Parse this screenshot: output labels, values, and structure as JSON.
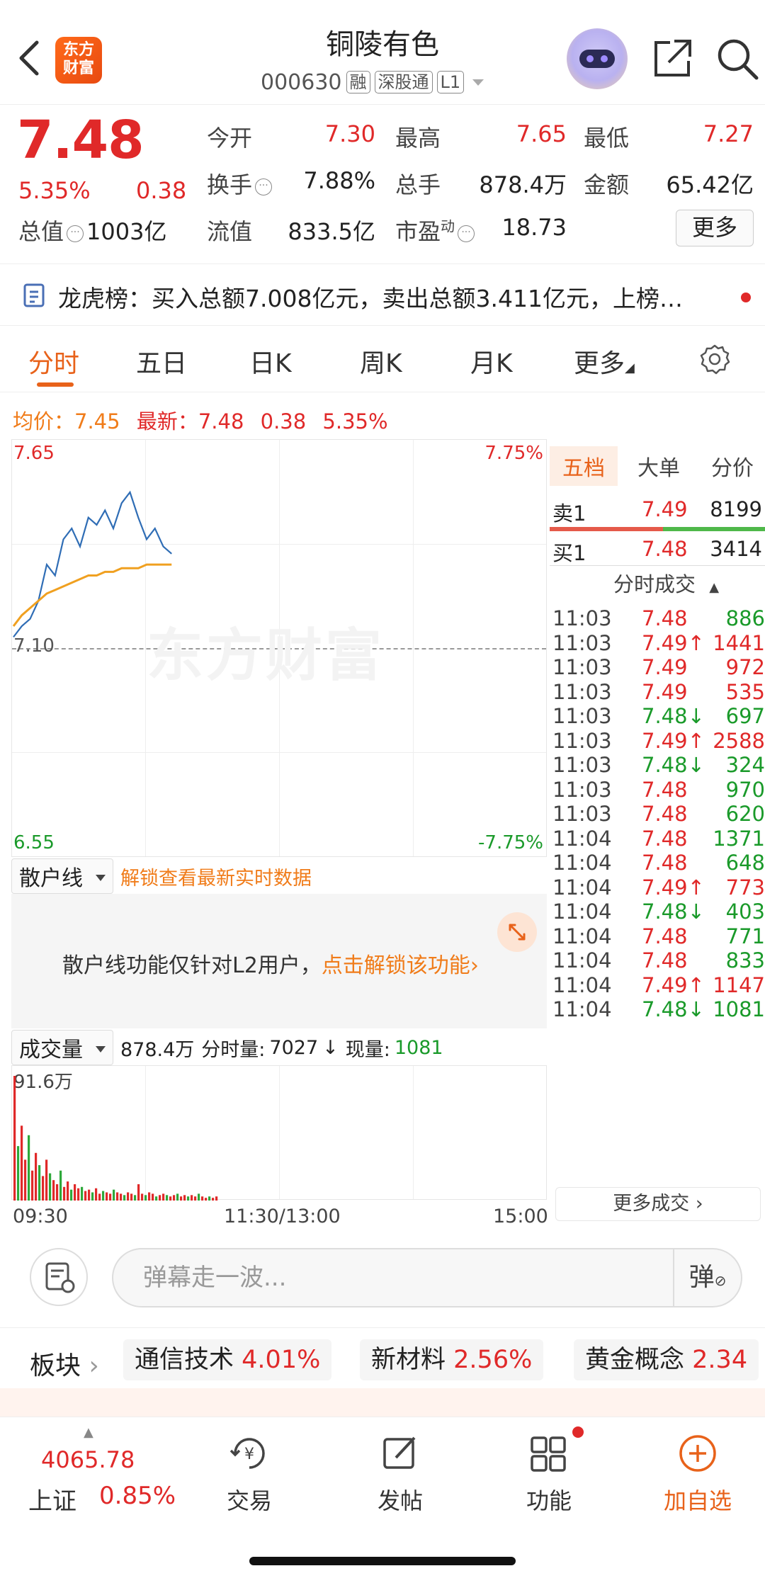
{
  "header": {
    "logo_text_1": "东方",
    "logo_text_2": "财富",
    "title": "铜陵有色",
    "code": "000630",
    "tags": [
      "融",
      "深股通",
      "L1"
    ]
  },
  "quote": {
    "price": "7.48",
    "change_pct": "5.35%",
    "change": "0.38",
    "total_value_label": "总值",
    "total_value": "1003亿",
    "open_label": "今开",
    "open": "7.30",
    "high_label": "最高",
    "high": "7.65",
    "low_label": "最低",
    "low": "7.27",
    "turnover_label": "换手",
    "turnover": "7.88%",
    "volume_label": "总手",
    "volume": "878.4万",
    "amount_label": "金额",
    "amount": "65.42亿",
    "float_label": "流值",
    "float": "833.5亿",
    "pe_label": "市盈",
    "pe_sup": "动",
    "pe": "18.73",
    "more_label": "更多"
  },
  "longhu": {
    "text": "龙虎榜：买入总额7.008亿元，卖出总额3.411亿元，上榜…"
  },
  "tabs": [
    "分时",
    "五日",
    "日K",
    "周K",
    "月K",
    "更多"
  ],
  "info": {
    "avg_label": "均价：",
    "avg": "7.45",
    "latest_label": "最新：",
    "latest": "7.48",
    "chg": "0.38",
    "pct": "5.35%"
  },
  "chart": {
    "price_high": "7.65",
    "price_low": "6.55",
    "pct_high": "7.75%",
    "pct_low": "-7.75%",
    "mid_price": "7.10",
    "watermark": "东方财富",
    "colors": {
      "price_line": "#2f6db5",
      "avg_line": "#f0a020"
    }
  },
  "chart_data": {
    "type": "line",
    "x": [
      "09:30",
      "09:35",
      "09:40",
      "09:45",
      "09:50",
      "09:55",
      "10:00",
      "10:05",
      "10:10",
      "10:15",
      "10:20",
      "10:25",
      "10:30",
      "10:35",
      "10:40",
      "10:45",
      "10:50",
      "10:55",
      "11:00",
      "11:05"
    ],
    "series": [
      {
        "name": "价格",
        "values": [
          7.25,
          7.28,
          7.3,
          7.35,
          7.45,
          7.42,
          7.52,
          7.55,
          7.5,
          7.58,
          7.56,
          7.6,
          7.55,
          7.62,
          7.65,
          7.58,
          7.52,
          7.55,
          7.5,
          7.48
        ]
      },
      {
        "name": "均价",
        "values": [
          7.28,
          7.31,
          7.33,
          7.35,
          7.37,
          7.38,
          7.39,
          7.4,
          7.41,
          7.42,
          7.42,
          7.43,
          7.43,
          7.44,
          7.44,
          7.44,
          7.45,
          7.45,
          7.45,
          7.45
        ]
      }
    ],
    "ylim": [
      6.55,
      7.65
    ],
    "volume": {
      "max_label": "91.6万",
      "bars": [
        91.6,
        40,
        55,
        30,
        48,
        22,
        35,
        26,
        18,
        30,
        20,
        15,
        12,
        22,
        10,
        14,
        8,
        12,
        9,
        10,
        7,
        8,
        6,
        9,
        5,
        7,
        6,
        5,
        8,
        6,
        5,
        4,
        6,
        5,
        4,
        12,
        5,
        4,
        6,
        5,
        3,
        4,
        5,
        4,
        3,
        4,
        5,
        3,
        4,
        3,
        4,
        3,
        5,
        3,
        2,
        3,
        2,
        3
      ]
    }
  },
  "sanhu": {
    "select_label": "散户线",
    "unlock_link": "解锁查看最新实时数据",
    "panel_text": "散户线功能仅针对L2用户，",
    "panel_link": "点击解锁该功能"
  },
  "volume_bar": {
    "select_label": "成交量",
    "total": "878.4万",
    "period_label": "分时量:",
    "period_val": "7027",
    "now_label": "现量:",
    "now_val": "1081"
  },
  "time_axis": [
    "09:30",
    "11:30/13:00",
    "15:00"
  ],
  "orderbook": {
    "tabs": [
      "五档",
      "大单",
      "分价"
    ],
    "sell1": {
      "label": "卖1",
      "price": "7.49",
      "vol": "8199"
    },
    "buy1": {
      "label": "买1",
      "price": "7.48",
      "vol": "3414"
    },
    "trades_title": "分时成交",
    "trades": [
      {
        "t": "11:03",
        "p": "7.48",
        "d": "",
        "v": "886",
        "c": "green"
      },
      {
        "t": "11:03",
        "p": "7.49",
        "d": "↑",
        "v": "1441",
        "c": "red"
      },
      {
        "t": "11:03",
        "p": "7.49",
        "d": "",
        "v": "972",
        "c": "red"
      },
      {
        "t": "11:03",
        "p": "7.49",
        "d": "",
        "v": "535",
        "c": "red"
      },
      {
        "t": "11:03",
        "p": "7.48",
        "d": "↓",
        "v": "697",
        "c": "green"
      },
      {
        "t": "11:03",
        "p": "7.49",
        "d": "↑",
        "v": "2588",
        "c": "red"
      },
      {
        "t": "11:03",
        "p": "7.48",
        "d": "↓",
        "v": "324",
        "c": "green"
      },
      {
        "t": "11:03",
        "p": "7.48",
        "d": "",
        "v": "970",
        "c": "green"
      },
      {
        "t": "11:03",
        "p": "7.48",
        "d": "",
        "v": "620",
        "c": "green"
      },
      {
        "t": "11:04",
        "p": "7.48",
        "d": "",
        "v": "1371",
        "c": "green"
      },
      {
        "t": "11:04",
        "p": "7.48",
        "d": "",
        "v": "648",
        "c": "green"
      },
      {
        "t": "11:04",
        "p": "7.49",
        "d": "↑",
        "v": "773",
        "c": "red"
      },
      {
        "t": "11:04",
        "p": "7.48",
        "d": "↓",
        "v": "403",
        "c": "green"
      },
      {
        "t": "11:04",
        "p": "7.48",
        "d": "",
        "v": "771",
        "c": "green"
      },
      {
        "t": "11:04",
        "p": "7.48",
        "d": "",
        "v": "833",
        "c": "green"
      },
      {
        "t": "11:04",
        "p": "7.49",
        "d": "↑",
        "v": "1147",
        "c": "red"
      },
      {
        "t": "11:04",
        "p": "7.48",
        "d": "↓",
        "v": "1081",
        "c": "green"
      }
    ],
    "more_label": "更多成交"
  },
  "danmu": {
    "placeholder": "弹幕走一波...",
    "btn": "弹"
  },
  "sectors": {
    "label": "板块",
    "items": [
      {
        "name": "通信技术",
        "pct": "4.01%"
      },
      {
        "name": "新材料",
        "pct": "2.56%"
      },
      {
        "name": "黄金概念",
        "pct": "2.34"
      }
    ]
  },
  "bottom_nav": {
    "index_value": "4065.78",
    "index_name": "上证",
    "index_pct": "0.85%",
    "items": [
      "交易",
      "发帖",
      "功能",
      "加自选"
    ]
  }
}
